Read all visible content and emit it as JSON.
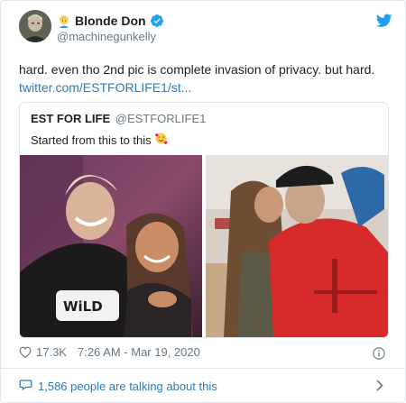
{
  "author": {
    "display_name": "Blonde Don",
    "handle": "@machinegunkelly",
    "emoji": "blond-person-emoji",
    "verified": true
  },
  "tweet": {
    "text": "hard. even tho 2nd pic is complete invasion of privacy. but hard.",
    "link": "twitter.com/ESTFORLIFE1/st..."
  },
  "quoted": {
    "display_name": "EST FOR LIFE",
    "handle": "@ESTFORLIFE1",
    "text": "Started from this to this",
    "emoji": "smiling-face-with-hearts-emoji",
    "images": [
      "photo-selfie",
      "photo-kiss"
    ]
  },
  "meta": {
    "likes": "17.3K",
    "timestamp": "7:26 AM - Mar 19, 2020"
  },
  "footer": {
    "talking": "1,586 people are talking about this"
  },
  "colors": {
    "link": "#2b7bb9",
    "twitter_blue": "#1da1f2",
    "secondary_text": "#697882",
    "border": "#e1e8ed"
  }
}
